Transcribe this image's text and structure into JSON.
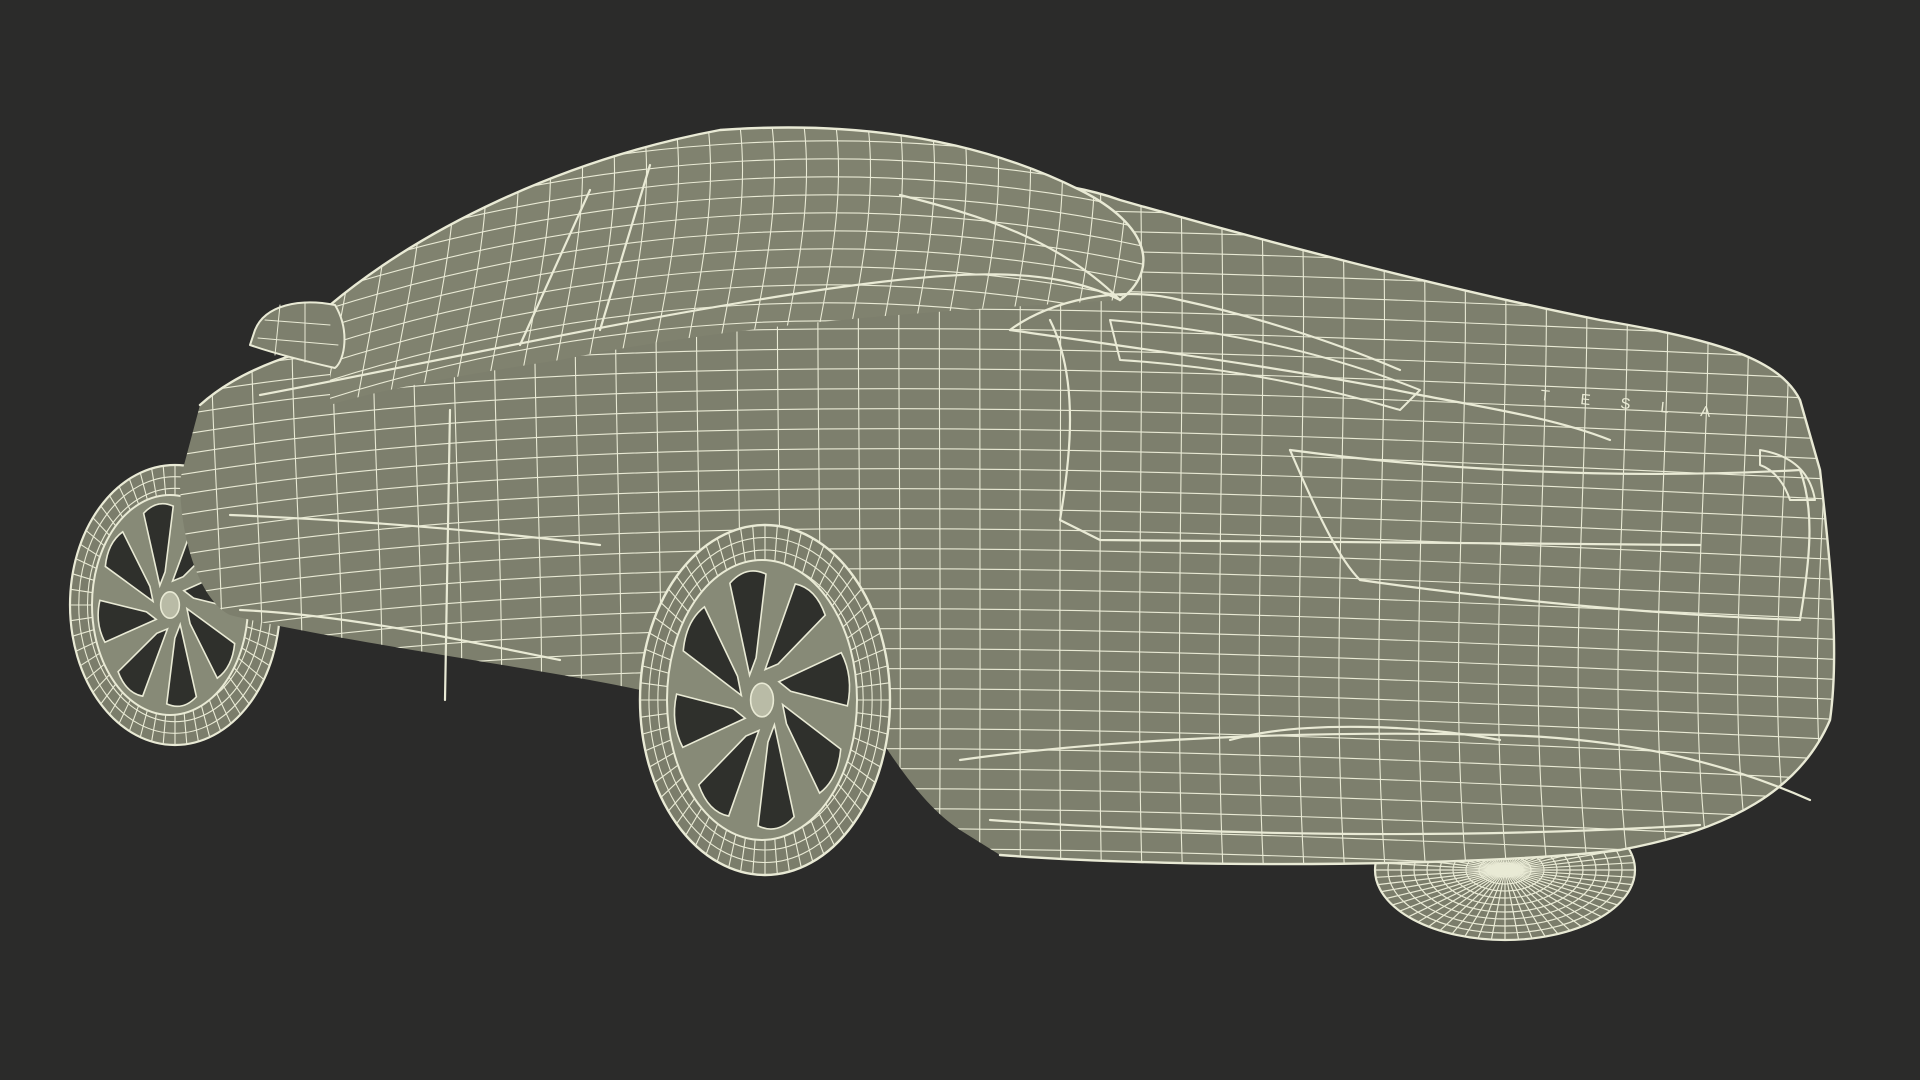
{
  "scene": {
    "subject": "car",
    "background_color": "#2b2b2a",
    "body_color": "#7d7f6d",
    "wire_color": "#e9ead5",
    "badge_text": "TESLA"
  }
}
